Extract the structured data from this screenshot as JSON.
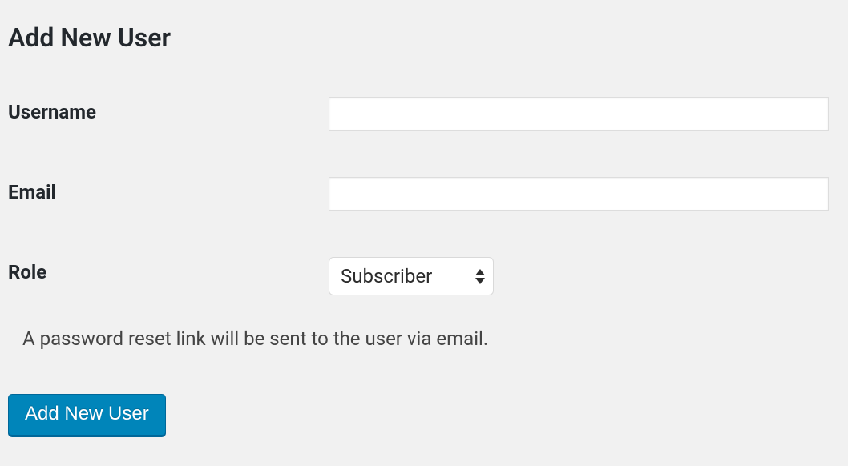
{
  "page": {
    "title": "Add New User"
  },
  "form": {
    "username": {
      "label": "Username",
      "value": "",
      "placeholder": ""
    },
    "email": {
      "label": "Email",
      "value": "",
      "placeholder": ""
    },
    "role": {
      "label": "Role",
      "selected": "Subscriber"
    },
    "hint": "A password reset link will be sent to the user via email.",
    "submit_label": "Add New User"
  }
}
